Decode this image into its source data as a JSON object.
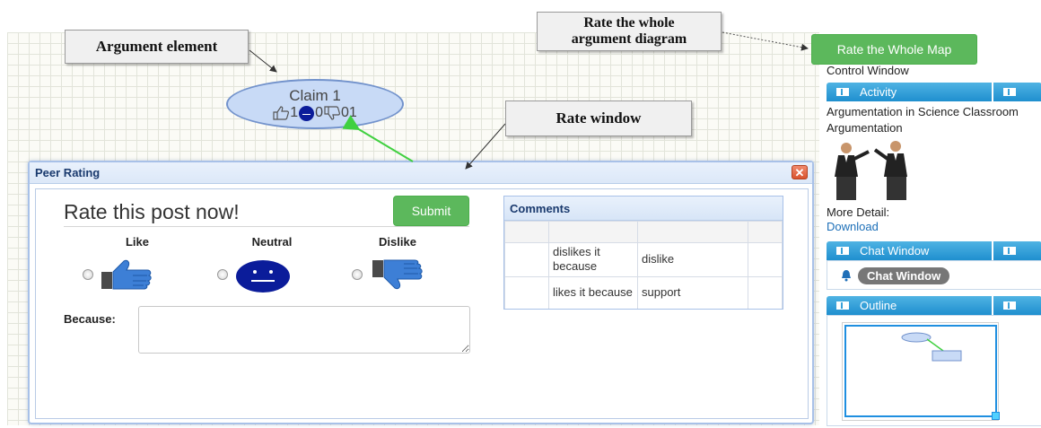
{
  "callouts": {
    "argument_element": "Argument element",
    "rate_window": "Rate window",
    "rate_whole_line1": "Rate the whole",
    "rate_whole_line2": "argument diagram"
  },
  "claim": {
    "title": "Claim 1",
    "likes": "1",
    "neutral": "0",
    "dislikes": "01"
  },
  "dialog": {
    "title": "Peer Rating",
    "close_symbol": "✕",
    "heading": "Rate this post now!",
    "submit_label": "Submit",
    "options": {
      "like": "Like",
      "neutral": "Neutral",
      "dislike": "Dislike"
    },
    "because_label": "Because:",
    "because_value": "",
    "comments": {
      "title": "Comments",
      "rows": [
        {
          "text": "dislikes it because",
          "type": "dislike"
        },
        {
          "text": "likes it because",
          "type": "support"
        }
      ]
    }
  },
  "sidebar": {
    "rate_whole_map": "Rate the Whole Map",
    "control_window": "Control Window",
    "activity": {
      "bar_title": "Activity",
      "title_line1": "Argumentation in Science Classroom",
      "title_line2": "Argumentation",
      "more_detail": "More Detail:",
      "download": "Download"
    },
    "chat": {
      "bar_title": "Chat Window",
      "pill": "Chat Window"
    },
    "outline": {
      "bar_title": "Outline"
    }
  },
  "colors": {
    "accent_green": "#5cb85c",
    "panel_blue": "#1f8fcf",
    "neutral_face": "#0b1c9a",
    "thumb_blue": "#3d7fd6",
    "node_fill": "#c8daf6"
  },
  "icons": {
    "like": "thumbs-up-icon",
    "neutral": "neutral-face-icon",
    "dislike": "thumbs-down-icon",
    "close": "close-icon",
    "bell": "bell-icon"
  }
}
